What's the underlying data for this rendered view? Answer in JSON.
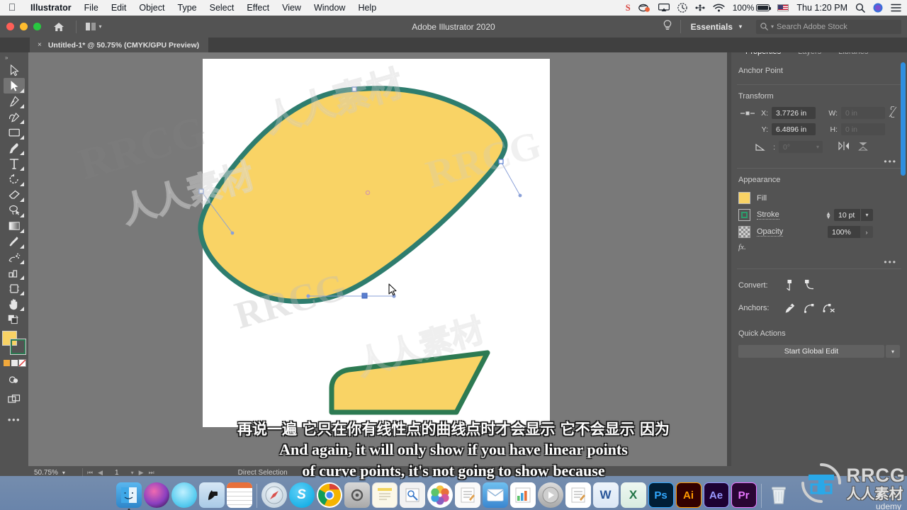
{
  "menubar": {
    "apple": "apple-logo",
    "items": [
      {
        "label": "Illustrator",
        "bold": true
      },
      {
        "label": "File",
        "bold": false
      },
      {
        "label": "Edit",
        "bold": false
      },
      {
        "label": "Object",
        "bold": false
      },
      {
        "label": "Type",
        "bold": false
      },
      {
        "label": "Select",
        "bold": false
      },
      {
        "label": "Effect",
        "bold": false
      },
      {
        "label": "View",
        "bold": false
      },
      {
        "label": "Window",
        "bold": false
      },
      {
        "label": "Help",
        "bold": false
      }
    ],
    "status": {
      "snagit": "S",
      "battery_percent": "100%",
      "clock": "Thu 1:20 PM"
    }
  },
  "titlebar": {
    "app_title": "Adobe Illustrator 2020",
    "workspace": "Essentials",
    "search_placeholder": "Search Adobe Stock"
  },
  "document_tab": {
    "title": "Untitled-1* @ 50.75% (CMYK/GPU Preview)",
    "close": "×"
  },
  "toolbar": {
    "tools": [
      {
        "name": "selection-tool",
        "selected": false
      },
      {
        "name": "direct-selection-tool",
        "selected": true
      },
      {
        "name": "pen-tool",
        "selected": false
      },
      {
        "name": "curvature-tool",
        "selected": false
      },
      {
        "name": "rectangle-tool",
        "selected": false
      },
      {
        "name": "paintbrush-tool",
        "selected": false
      },
      {
        "name": "type-tool",
        "selected": false
      },
      {
        "name": "rotate-tool",
        "selected": false
      },
      {
        "name": "eraser-tool",
        "selected": false
      },
      {
        "name": "lasso-tool",
        "selected": false
      },
      {
        "name": "gradient-tool",
        "selected": false
      },
      {
        "name": "eyedropper-tool",
        "selected": false
      },
      {
        "name": "blend-tool",
        "selected": false
      },
      {
        "name": "symbol-sprayer-tool",
        "selected": false
      },
      {
        "name": "artboard-tool",
        "selected": false
      },
      {
        "name": "hand-tool",
        "selected": false
      }
    ],
    "fill_color": "#F9D365",
    "stroke_color": "#2D7A52"
  },
  "panel": {
    "tabs": [
      {
        "label": "Properties",
        "active": true
      },
      {
        "label": "Layers",
        "active": false
      },
      {
        "label": "Libraries",
        "active": false
      }
    ],
    "anchor_point": {
      "title": "Anchor Point"
    },
    "transform": {
      "title": "Transform",
      "x_label": "X:",
      "x_value": "3.7726 in",
      "y_label": "Y:",
      "y_value": "6.4896 in",
      "w_label": "W:",
      "w_value": "0 in",
      "h_label": "H:",
      "h_value": "0 in",
      "angle_label": "∠:",
      "angle_value": "0°"
    },
    "appearance": {
      "title": "Appearance",
      "fill_label": "Fill",
      "fill_color": "#F9D365",
      "stroke_label": "Stroke",
      "stroke_color": "#2D9C6D",
      "stroke_weight": "10 pt",
      "opacity_label": "Opacity",
      "opacity_value": "100%",
      "fx_label": "fx."
    },
    "convert": {
      "label": "Convert:"
    },
    "anchors": {
      "label": "Anchors:"
    },
    "quick_actions": {
      "title": "Quick Actions",
      "button": "Start Global Edit"
    }
  },
  "statusbar": {
    "zoom": "50.75%",
    "page": "1",
    "tool": "Direct Selection"
  },
  "canvas": {
    "shape_a": {
      "name": "rounded-blob-shape",
      "fill": "#F9D365",
      "stroke": "#2E7D6E"
    },
    "shape_b": {
      "name": "quad-shape",
      "fill": "#F9D365",
      "stroke": "#2D7A52"
    },
    "cursor": "direct-selection-cursor"
  },
  "subtitles": {
    "chinese": "再说一遍 它只在你有线性点的曲线点时才会显示 它不会显示 因为",
    "english_line1": "And again, it will only show if you have linear points",
    "english_line2": "of curve points, it's not going to show because"
  },
  "dock": {
    "items": [
      {
        "name": "finder",
        "label": "",
        "color": "#3b9ddd"
      },
      {
        "name": "siri",
        "label": "",
        "color": "#6d3f8f"
      },
      {
        "name": "launchpad",
        "label": "",
        "color": "#69c9ec"
      },
      {
        "name": "ibooks",
        "label": "",
        "color": "#d8e4f0"
      },
      {
        "name": "calendar",
        "label": "",
        "color": "#f2f2f2"
      },
      {
        "name": "safari",
        "label": "",
        "color": "#c9d5de"
      },
      {
        "name": "skype",
        "label": "S",
        "color": "#2cb2e8"
      },
      {
        "name": "chrome",
        "label": "",
        "color": "#f0f0f0"
      },
      {
        "name": "system-preferences",
        "label": "",
        "color": "#c4c4c4"
      },
      {
        "name": "notes",
        "label": "",
        "color": "#f7f5ee"
      },
      {
        "name": "preview",
        "label": "",
        "color": "#eeeeee"
      },
      {
        "name": "photos",
        "label": "",
        "color": "#f5f5f5"
      },
      {
        "name": "textedit",
        "label": "",
        "color": "#f0f0f0"
      },
      {
        "name": "mail",
        "label": "",
        "color": "#5aa9e6"
      },
      {
        "name": "numbers",
        "label": "",
        "color": "#e8eef2"
      },
      {
        "name": "quicktime",
        "label": "",
        "color": "#bcbcbc"
      },
      {
        "name": "pages",
        "label": "",
        "color": "#f2f2f2"
      },
      {
        "name": "word",
        "label": "W",
        "color": "#2b579a"
      },
      {
        "name": "excel",
        "label": "X",
        "color": "#217346"
      },
      {
        "name": "photoshop",
        "label": "Ps",
        "color": "#001e36"
      },
      {
        "name": "illustrator",
        "label": "Ai",
        "color": "#330000"
      },
      {
        "name": "after-effects",
        "label": "Ae",
        "color": "#1d0133"
      },
      {
        "name": "premiere",
        "label": "Pr",
        "color": "#2a0634"
      },
      {
        "name": "trash",
        "label": "",
        "color": "#dddddd"
      }
    ]
  },
  "watermark": {
    "brand": "RRCG",
    "brand_cn": "人人素材",
    "platform": "udemy"
  }
}
